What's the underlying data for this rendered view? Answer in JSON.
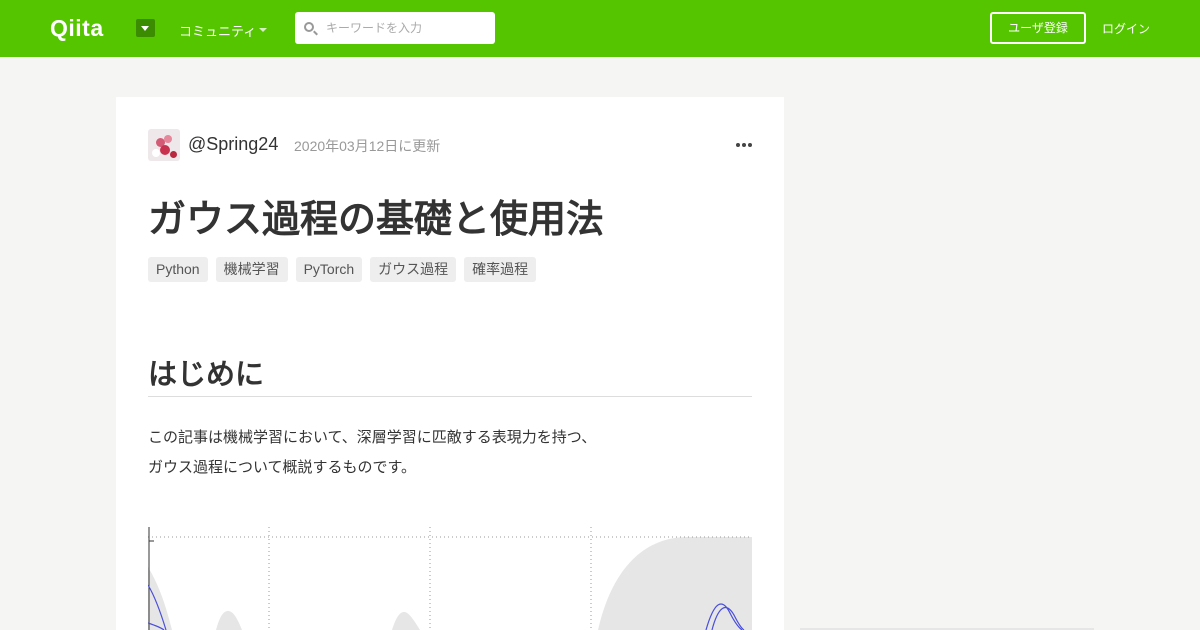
{
  "header": {
    "logo_text": "Qiita",
    "community_label": "コミュニティ",
    "search_placeholder": "キーワードを入力",
    "signup_label": "ユーザ登録",
    "login_label": "ログイン",
    "brand_color": "#55c500"
  },
  "article": {
    "author": "@Spring24",
    "updated": "2020年03月12日に更新",
    "title": "ガウス過程の基礎と使用法",
    "tags": [
      "Python",
      "機械学習",
      "PyTorch",
      "ガウス過程",
      "確率過程"
    ],
    "heading": "はじめに",
    "paragraph_lines": [
      "この記事は機械学習において、深層学習に匹敵する表現力を持つ、",
      "ガウス過程について概説するものです。"
    ]
  },
  "icons": [
    "search-icon",
    "dropdown-caret-icon",
    "more-options-icon"
  ]
}
